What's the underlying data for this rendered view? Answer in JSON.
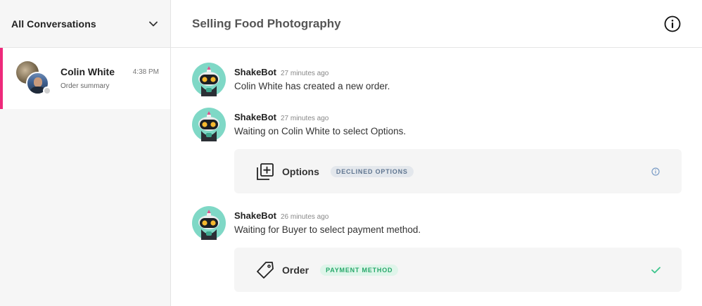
{
  "sidebar": {
    "filter_label": "All Conversations",
    "conversation": {
      "name": "Colin White",
      "time": "4:38 PM",
      "subtitle": "Order summary"
    }
  },
  "main": {
    "title": "Selling Food Photography",
    "messages": [
      {
        "sender": "ShakeBot",
        "time": "27 minutes ago",
        "text": "Colin White has created a new order."
      },
      {
        "sender": "ShakeBot",
        "time": "27 minutes ago",
        "text": "Waiting on Colin White to select Options.",
        "card": {
          "label": "Options",
          "badge": "DECLINED OPTIONS",
          "icon": "add-copy-icon",
          "end_icon": "info-icon"
        }
      },
      {
        "sender": "ShakeBot",
        "time": "26 minutes ago",
        "text": "Waiting for Buyer to select payment method.",
        "card": {
          "label": "Order",
          "badge": "PAYMENT METHOD",
          "icon": "tag-icon",
          "end_icon": "check-icon"
        }
      }
    ]
  },
  "colors": {
    "accent": "#ee2a7b",
    "bot_teal": "#7fd8c6",
    "badge_gray_bg": "#e3e7ec",
    "badge_gray_text": "#5f7590",
    "badge_green_bg": "#dff5ea",
    "badge_green_text": "#27a86a",
    "info_blue": "#7a9cc6",
    "check_green": "#3cc58c"
  }
}
